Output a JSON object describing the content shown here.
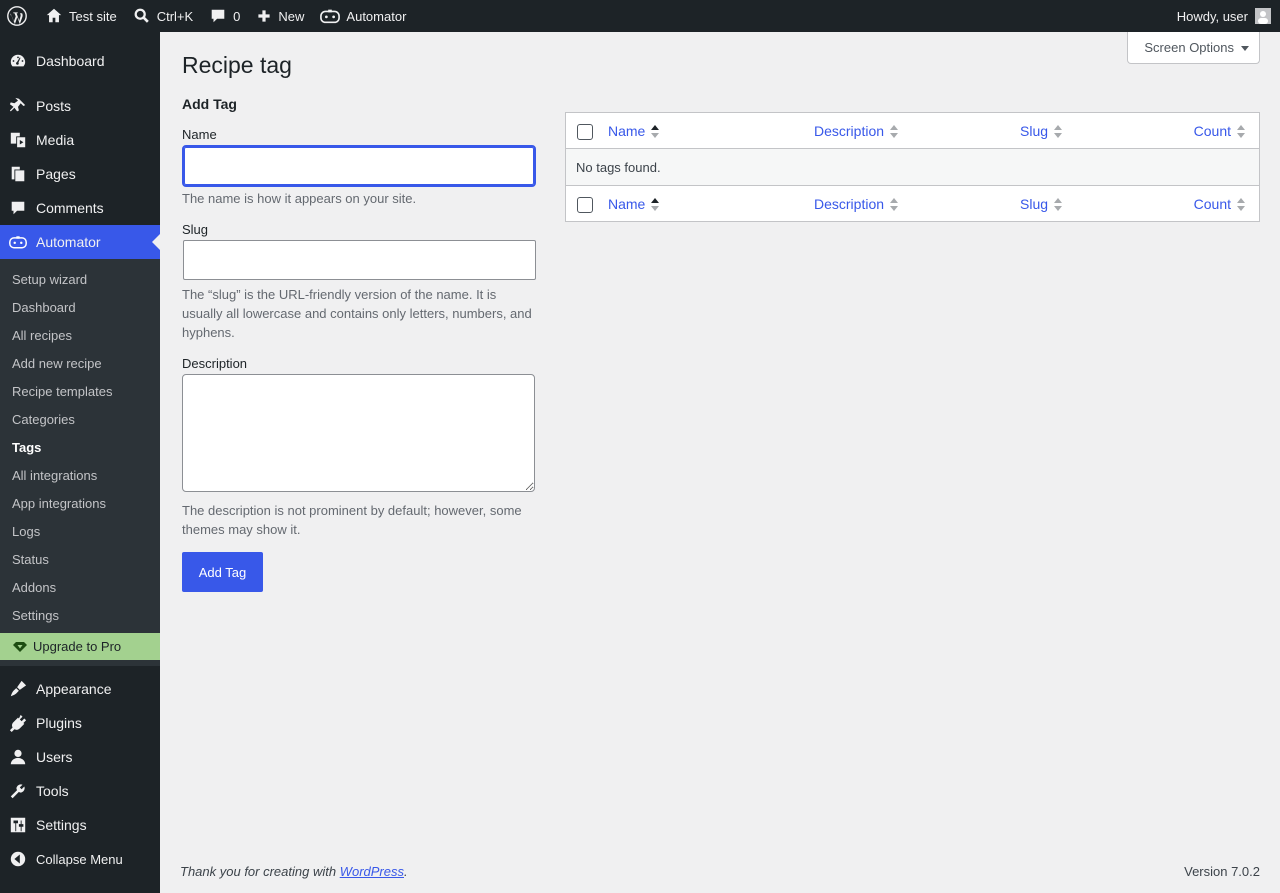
{
  "adminbar": {
    "site_name": "Test site",
    "search_shortcut": "Ctrl+K",
    "comments_count": "0",
    "new_label": "New",
    "automator_label": "Automator",
    "howdy": "Howdy, user"
  },
  "sidebar": {
    "dashboard": "Dashboard",
    "posts": "Posts",
    "media": "Media",
    "pages": "Pages",
    "comments": "Comments",
    "automator": "Automator",
    "submenu": [
      "Setup wizard",
      "Dashboard",
      "All recipes",
      "Add new recipe",
      "Recipe templates",
      "Categories",
      "Tags",
      "All integrations",
      "App integrations",
      "Logs",
      "Status",
      "Addons",
      "Settings"
    ],
    "upgrade": "Upgrade to Pro",
    "appearance": "Appearance",
    "plugins": "Plugins",
    "users": "Users",
    "tools": "Tools",
    "settings": "Settings",
    "collapse": "Collapse Menu"
  },
  "screen_options": "Screen Options",
  "page_title": "Recipe tag",
  "form": {
    "heading": "Add Tag",
    "name_label": "Name",
    "name_value": "",
    "name_help": "The name is how it appears on your site.",
    "slug_label": "Slug",
    "slug_value": "",
    "slug_help": "The “slug” is the URL-friendly version of the name. It is usually all lowercase and contains only letters, numbers, and hyphens.",
    "description_label": "Description",
    "description_help": "The description is not prominent by default; however, some themes may show it.",
    "submit": "Add Tag"
  },
  "table": {
    "columns": [
      "Name",
      "Description",
      "Slug",
      "Count"
    ],
    "empty": "No tags found."
  },
  "footer": {
    "thanks_prefix": "Thank you for creating with ",
    "thanks_link": "WordPress",
    "thanks_suffix": ".",
    "version": "Version 7.0.2"
  },
  "colors": {
    "accent": "#3858e9",
    "adminbar": "#1d2327",
    "upgrade": "#a3d18f"
  }
}
